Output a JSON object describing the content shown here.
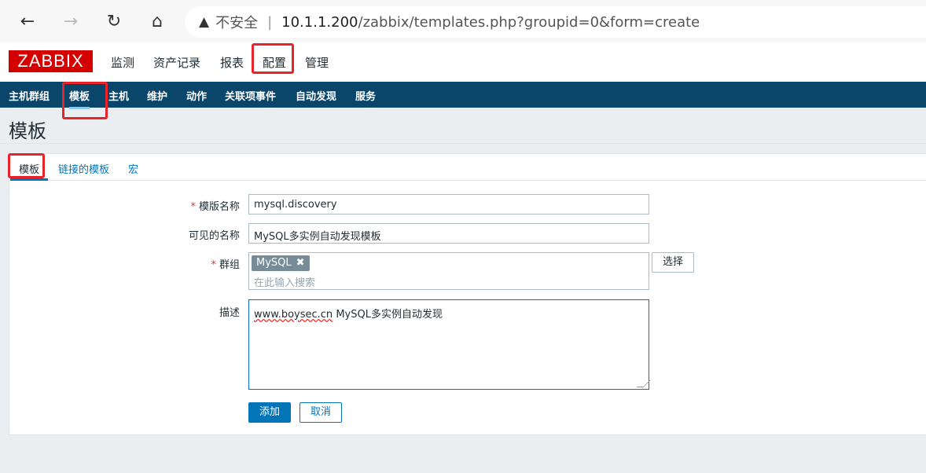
{
  "browser": {
    "back_icon": "←",
    "forward_icon": "→",
    "reload_icon": "↻",
    "home_icon": "⌂",
    "warning_icon": "▲",
    "insecure_label": "不安全",
    "separator": "|",
    "url_host": "10.1.1.200",
    "url_path": "/zabbix/templates.php?groupid=0&form=create"
  },
  "header": {
    "logo": "ZABBIX",
    "menu": [
      "监测",
      "资产记录",
      "报表",
      "配置",
      "管理"
    ]
  },
  "submenu": {
    "items": [
      "主机群组",
      "模板",
      "主机",
      "维护",
      "动作",
      "关联项事件",
      "自动发现",
      "服务"
    ]
  },
  "page": {
    "title": "模板"
  },
  "tabs": [
    "模板",
    "链接的模板",
    "宏"
  ],
  "form": {
    "template_name_label": "模版名称",
    "template_name_value": "mysql.discovery",
    "visible_name_label": "可见的名称",
    "visible_name_value": "MySQL多实例自动发现模板",
    "groups_label": "群组",
    "group_chip": "MySQL",
    "group_chip_remove": "✖",
    "groups_placeholder": "在此输入搜索",
    "select_button": "选择",
    "description_label": "描述",
    "description_link": "www.boysec.cn",
    "description_rest": " MySQL多实例自动发现",
    "add_button": "添加",
    "cancel_button": "取消",
    "required_mark": "*"
  },
  "colors": {
    "brand": "#d40000",
    "nav_bar": "#0a466a",
    "primary": "#0275b8",
    "highlight": "#e8242a"
  }
}
